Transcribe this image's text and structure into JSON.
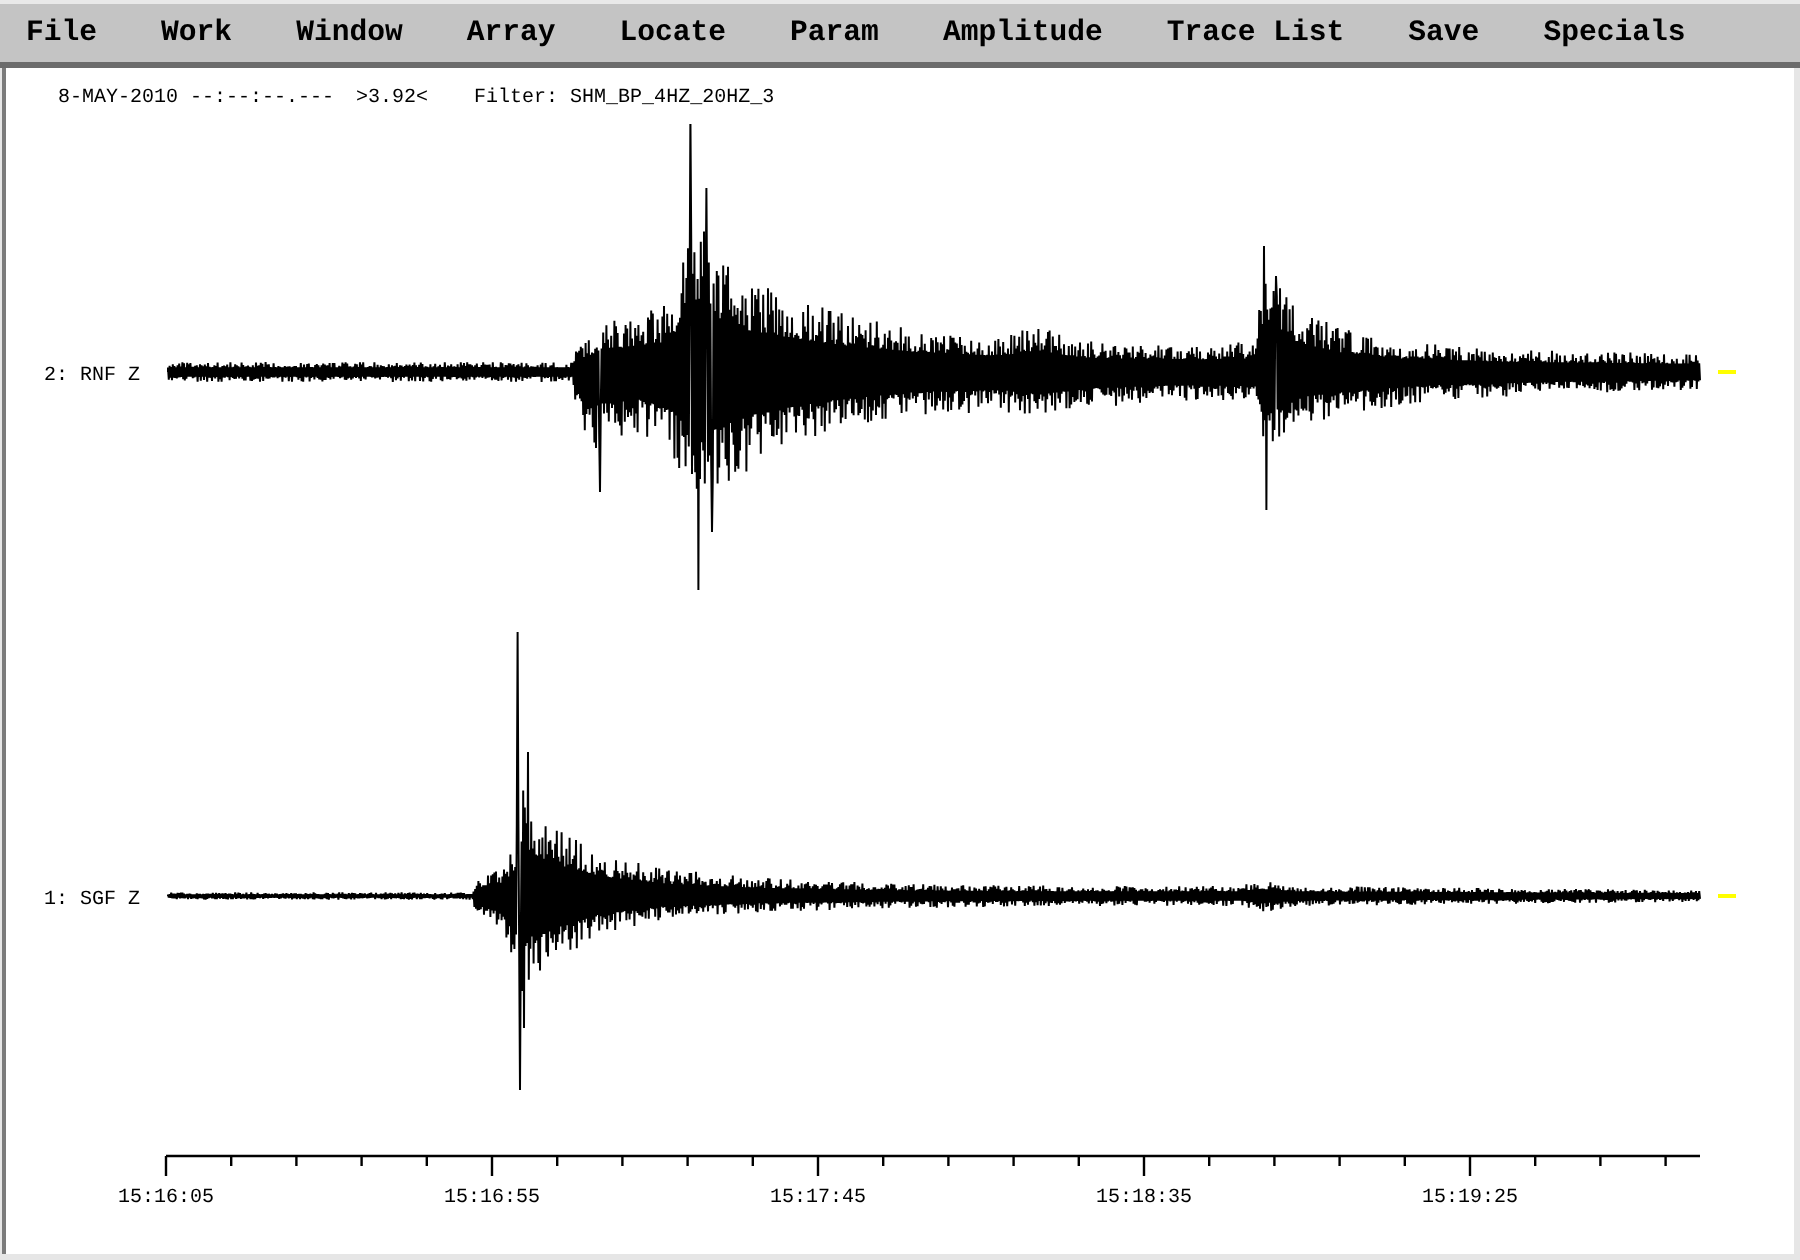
{
  "menu_bar": {
    "items": [
      "File",
      "Work",
      "Window",
      "Array",
      "Locate",
      "Param",
      "Amplitude",
      "Trace List",
      "Save",
      "Specials"
    ]
  },
  "header": {
    "date_time": "8-MAY-2010 --:--:--.---",
    "amplitude": ">3.92<",
    "filter": "Filter: SHM_BP_4HZ_20HZ_3"
  },
  "traces": [
    {
      "label": "2: RNF Z"
    },
    {
      "label": "1: SGF Z"
    }
  ],
  "time_axis": {
    "ticks": [
      "15:16:05",
      "15:16:55",
      "15:17:45",
      "15:18:35",
      "15:19:25"
    ]
  }
}
